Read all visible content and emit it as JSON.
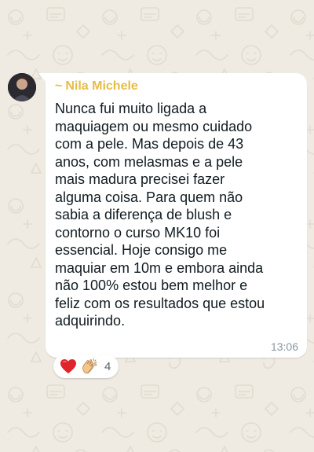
{
  "message": {
    "sender_prefix": "~",
    "sender_name": "Nila Michele",
    "text": "Nunca fui muito ligada a\nmaquiagem ou mesmo cuidado\ncom a pele. Mas depois de 43\nanos, com melasmas e a pele\nmais madura precisei fazer\nalguma coisa. Para quem não\nsabia a diferença de blush e\ncontorno o curso MK10 foi\nessencial. Hoje consigo me\nmaquiar em 10m e embora ainda\nnão 100% estou bem melhor e\nfeliz com os resultados que estou\nadquirindo.",
    "time": "13:06"
  },
  "reactions": {
    "icons": [
      "red-heart-icon",
      "clapping-hands-icon"
    ],
    "count": "4"
  },
  "colors": {
    "background": "#efeae2",
    "bubble": "#ffffff",
    "sender_name": "#e6bd43",
    "text": "#111b21",
    "timestamp": "#8696a0"
  }
}
